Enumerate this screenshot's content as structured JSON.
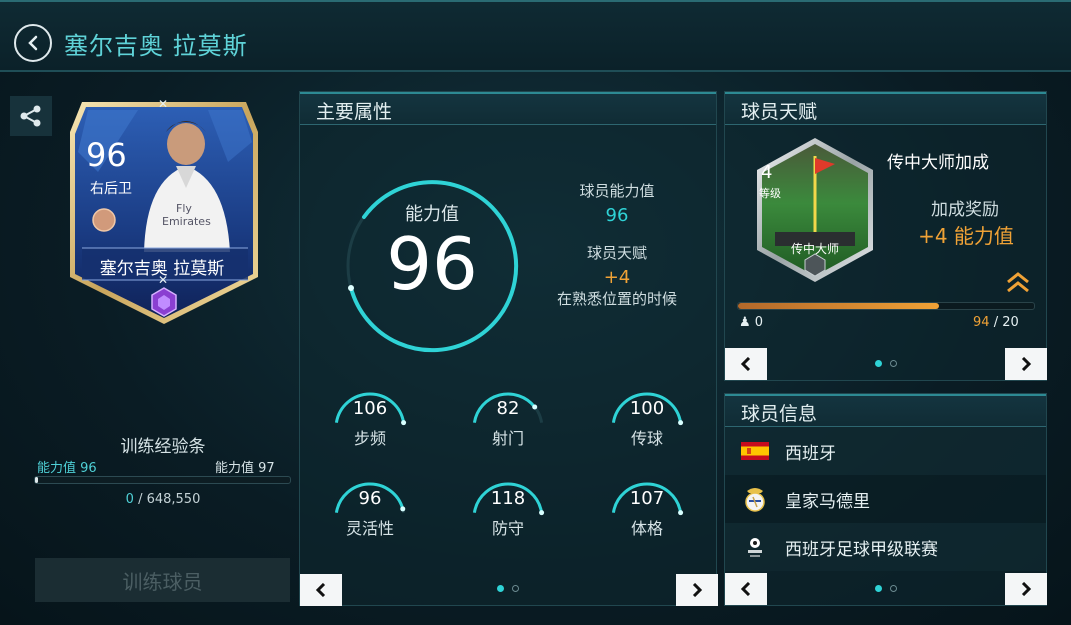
{
  "header": {
    "title": "塞尔吉奥 拉莫斯"
  },
  "card": {
    "rating": "96",
    "position": "右后卫",
    "name": "塞尔吉奥 拉莫斯"
  },
  "xp": {
    "title": "训练经验条",
    "left_label": "能力值",
    "left_value": "96",
    "right_label": "能力值",
    "right_value": "97",
    "current": "0",
    "separator": "/",
    "total": "648,550",
    "progress": 0.01
  },
  "train_button": "训练球员",
  "main": {
    "title": "主要属性",
    "ovr_label": "能力值",
    "ovr_value": "96",
    "player_ovr_label": "球员能力值",
    "player_ovr_value": "96",
    "talent_label": "球员天赋",
    "talent_value": "+4",
    "talent_note": "在熟悉位置的时候",
    "stats": [
      {
        "value": "106",
        "label": "步频",
        "fill": 1.0
      },
      {
        "value": "82",
        "label": "射门",
        "fill": 0.82
      },
      {
        "value": "100",
        "label": "传球",
        "fill": 1.0
      },
      {
        "value": "96",
        "label": "灵活性",
        "fill": 0.96
      },
      {
        "value": "118",
        "label": "防守",
        "fill": 1.0
      },
      {
        "value": "107",
        "label": "体格",
        "fill": 1.0
      }
    ]
  },
  "talent": {
    "title": "球员天赋",
    "level": "4",
    "level_label": "等级",
    "badge_name": "传中大师",
    "name": "传中大师加成",
    "bonus_label": "加成奖励",
    "bonus_value": "+4 能力值",
    "min": "0",
    "progress_current": "94",
    "progress_sep": "/",
    "progress_total": "20",
    "progress": 0.68
  },
  "info": {
    "title": "球员信息",
    "nation": "西班牙",
    "club": "皇家马德里",
    "league": "西班牙足球甲级联赛"
  },
  "colors": {
    "accent": "#2fd3d6",
    "orange": "#f0a236",
    "panel": "#0e2830"
  }
}
